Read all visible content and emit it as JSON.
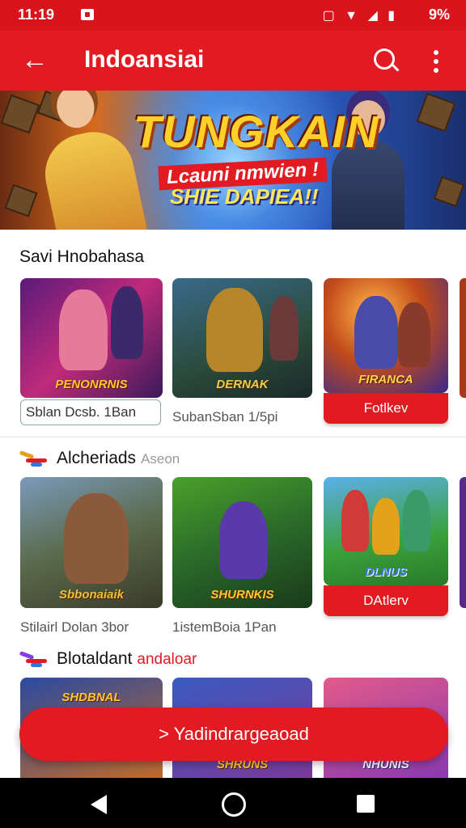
{
  "status": {
    "time": "11:19",
    "signal_icons": "▢ ▼ ◢ ▮",
    "battery": "9%"
  },
  "appbar": {
    "title": "Indoansiai",
    "back_icon": "←"
  },
  "banner": {
    "title": "TUNGKAIN",
    "subtitle": "Lcauni nmwien !",
    "tagline": "SHIE DAPIEA!!"
  },
  "sections": [
    {
      "title": "Savi Hnobahasa",
      "sub": "",
      "cards": [
        {
          "caption": "PENONRNIS",
          "label": "Sblan Dcsb. 1Ban"
        },
        {
          "caption": "DERNAK",
          "label": "SubanSban 1/5pi"
        },
        {
          "caption": "FIRANCA",
          "button": "Fotlkev"
        }
      ]
    },
    {
      "title": "Alcheriads",
      "sub": "Aseon",
      "cards": [
        {
          "caption": "Sbbonaiaik",
          "label": "Stilairl Dolan 3bor"
        },
        {
          "caption": "SHURNKIS",
          "label": "1istemBoia 1Pan"
        },
        {
          "caption": "DLNUS",
          "button": "DAtlerv"
        }
      ]
    },
    {
      "title": "Blotaldant",
      "sub": "andaloar",
      "cards": [
        {
          "caption": "SHDBNAL"
        },
        {
          "caption": "SHRUNS"
        },
        {
          "caption": "NHUNIS"
        }
      ]
    }
  ],
  "cta": {
    "label": "> Yadindrargeaoad"
  },
  "colors": {
    "brand": "#e21b23",
    "status": "#d9141b"
  }
}
